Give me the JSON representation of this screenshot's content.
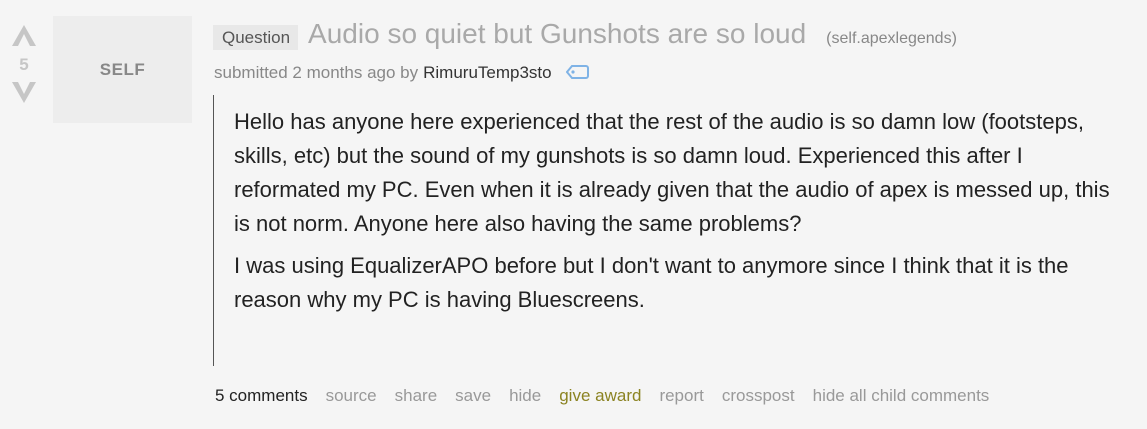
{
  "post": {
    "score": "5",
    "thumbnail_label": "SELF",
    "flair": "Question",
    "title": "Audio so quiet but Gunshots are so loud",
    "domain": "(self.apexlegends)",
    "tagline_prefix": "submitted 2 months ago by",
    "author": "RimuruTemp3sto",
    "selftext": [
      "Hello has anyone here experienced that the rest of the audio is so damn low (footsteps, skills, etc) but the sound of my gunshots is so damn loud. Experienced this after I reformated my PC. Even when it is already given that the audio of apex is messed up, this is not norm. Anyone here also having the same problems?",
      "I was using EqualizerAPO before but I don't want to anymore since I think that it is the reason why my PC is having Bluescreens."
    ]
  },
  "buttons": {
    "comments": "5 comments",
    "source": "source",
    "share": "share",
    "save": "save",
    "hide": "hide",
    "give_award": "give award",
    "report": "report",
    "crosspost": "crosspost",
    "hide_child": "hide all child comments"
  },
  "icons": {
    "upvote": "upvote-arrow-icon",
    "downvote": "downvote-arrow-icon",
    "tag": "tag-icon"
  },
  "colors": {
    "background": "#f5f5f5",
    "award": "#8b8322",
    "tag_icon": "#7fb3e6",
    "arrow": "#c6c6c6"
  }
}
